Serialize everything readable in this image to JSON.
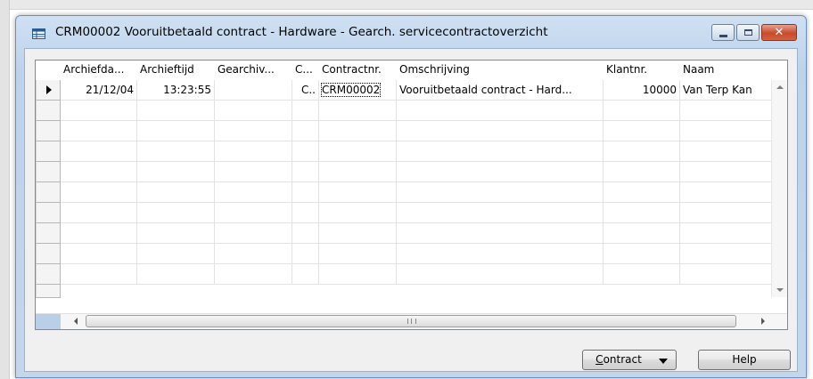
{
  "window": {
    "title": "CRM00002 Vooruitbetaald contract - Hardware - Gearch. servicecontractoverzicht",
    "icon": "table-form-icon"
  },
  "grid": {
    "columns": [
      {
        "label": "Archiefda..."
      },
      {
        "label": "Archieftijd"
      },
      {
        "label": "Gearchiv..."
      },
      {
        "label": "C..."
      },
      {
        "label": "Contractnr."
      },
      {
        "label": "Omschrijving"
      },
      {
        "label": "Klantnr."
      },
      {
        "label": "Naam"
      }
    ],
    "rows": [
      {
        "archiefdatum": "21/12/04",
        "archieftijd": "13:23:55",
        "gearchiveerd": "",
        "c": "C..",
        "contractnr": "CRM00002",
        "omschrijving": "Vooruitbetaald contract - Hard...",
        "klantnr": "10000",
        "naam": "Van Terp Kan"
      }
    ]
  },
  "buttons": {
    "contract_label_underlined": "C",
    "contract_label_rest": "ontract",
    "help_label": "Help"
  }
}
